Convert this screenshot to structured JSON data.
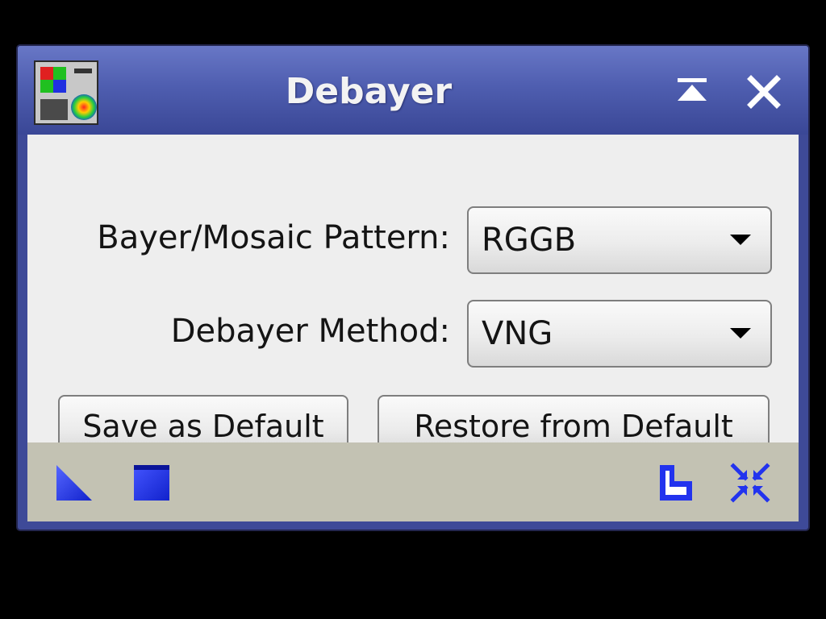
{
  "window": {
    "title": "Debayer"
  },
  "form": {
    "pattern_label": "Bayer/Mosaic Pattern:",
    "pattern_value": "RGGB",
    "method_label": "Debayer Method:",
    "method_value": "VNG"
  },
  "buttons": {
    "save_default": "Save as Default",
    "restore_default": "Restore from Default"
  },
  "icons": {
    "app": "debayer-app-icon",
    "shade": "shade-icon",
    "close": "close-icon",
    "new_instance": "new-instance-icon",
    "apply_global": "apply-global-icon",
    "reset": "reset-icon",
    "preview": "real-time-preview-icon"
  },
  "colors": {
    "titlebar": "#4f5eb0",
    "content_bg": "#eeeeee",
    "bottombar_bg": "#c3c2b3",
    "tool_icon_blue": "#2233ee"
  }
}
